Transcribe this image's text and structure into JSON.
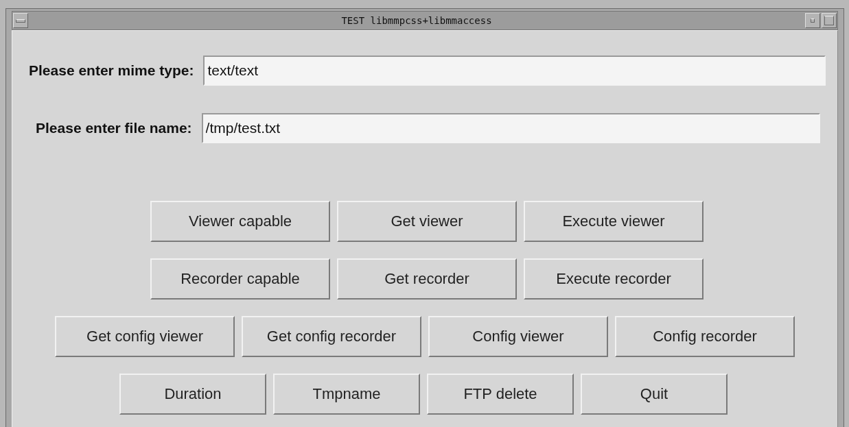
{
  "window": {
    "title": "TEST libmmpcss+libmmaccess"
  },
  "fields": [
    {
      "label": "Please enter mime type:",
      "value": "text/text"
    },
    {
      "label": "Please enter file name:",
      "value": "/tmp/test.txt"
    }
  ],
  "button_rows": [
    [
      "Viewer capable",
      "Get viewer",
      "Execute viewer"
    ],
    [
      "Recorder capable",
      "Get recorder",
      "Execute recorder"
    ],
    [
      "Get config viewer",
      "Get config recorder",
      "Config viewer",
      "Config recorder"
    ],
    [
      "Duration",
      "Tmpname",
      "FTP delete",
      "Quit"
    ]
  ]
}
